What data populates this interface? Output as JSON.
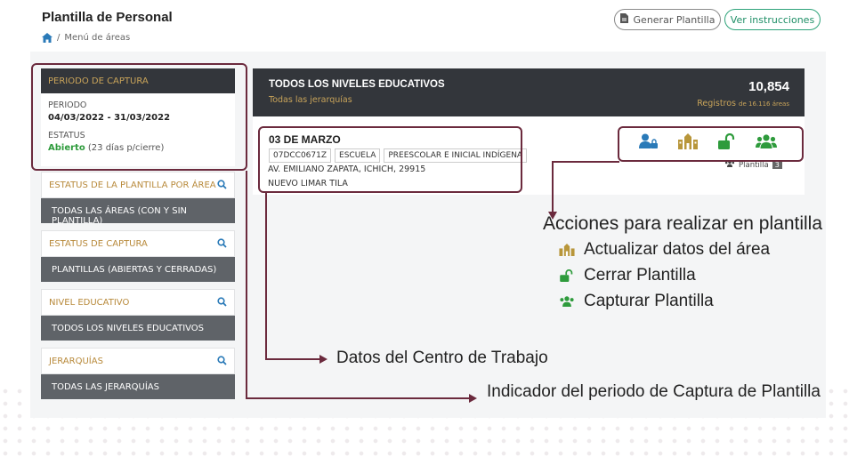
{
  "header": {
    "title": "Plantilla de Personal",
    "breadcrumb": "Menú de áreas",
    "generate_button": "Generar Plantilla",
    "instructions_button": "Ver instrucciones"
  },
  "period": {
    "head": "PERIODO DE CAPTURA",
    "period_label": "PERIODO",
    "period_value": "04/03/2022 - 31/03/2022",
    "status_label": "ESTATUS",
    "status_value": "Abierto",
    "status_note": "(23 días p/cierre)"
  },
  "filters": [
    {
      "label": "ESTATUS DE LA PLANTILLA POR ÁREA",
      "value": "TODAS LAS ÁREAS (CON Y SIN PLANTILLA)"
    },
    {
      "label": "ESTATUS DE CAPTURA",
      "value": "PLANTILLAS (ABIERTAS Y CERRADAS)"
    },
    {
      "label": "NIVEL EDUCATIVO",
      "value": "TODOS LOS NIVELES EDUCATIVOS"
    },
    {
      "label": "JERARQUÍAS",
      "value": "TODAS LAS JERARQUÍAS"
    }
  ],
  "panel": {
    "title": "TODOS LOS NIVELES EDUCATIVOS",
    "subtitle": "Todas las jerarquías",
    "count": "10,854",
    "registros": "Registros",
    "areas_note": "de 16.116 áreas"
  },
  "school": {
    "name": "03 DE MARZO",
    "chips": [
      "07DCC0671Z",
      "ESCUELA",
      "PREESCOLAR E INICIAL INDÍGENA"
    ],
    "address1": "AV. EMILIANO ZAPATA, ICHICH, 29915",
    "address2": "NUEVO LIMAR TILA",
    "plantilla_label": "Plantilla",
    "plantilla_count": "3"
  },
  "annotations": {
    "actions_title": "Acciones para  realizar  en  plantilla",
    "legend": [
      {
        "icon": "building-icon",
        "text": "Actualizar datos del área"
      },
      {
        "icon": "unlock-icon",
        "text": "Cerrar Plantilla"
      },
      {
        "icon": "users-icon",
        "text": "Capturar Plantilla"
      }
    ],
    "datos_centro": "Datos del Centro de Trabajo",
    "indicador_periodo": "Indicador del periodo de Captura de Plantilla"
  },
  "colors": {
    "dark_header": "#33363b",
    "gold": "#c9a45a",
    "green": "#2e9b3c",
    "annotation": "#6b2a3d",
    "filter_bar": "#5f6368"
  }
}
